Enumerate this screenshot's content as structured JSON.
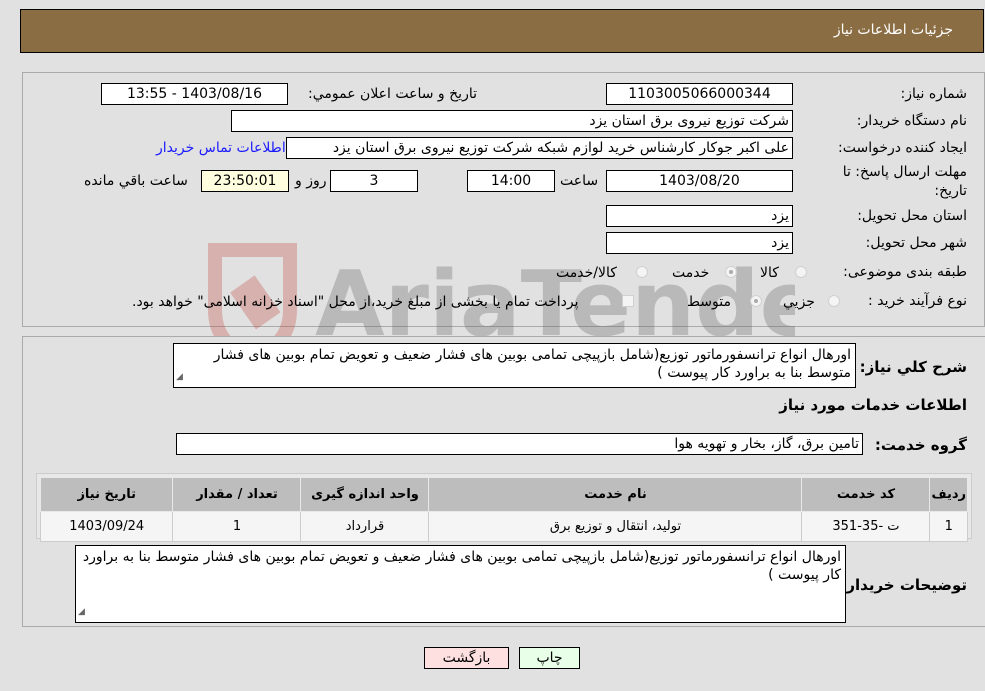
{
  "header": {
    "title": "جزئیات اطلاعات نیاز"
  },
  "fields": {
    "need_number": {
      "label": "شماره نیاز:",
      "value": "1103005066000344"
    },
    "announce_datetime": {
      "label": "تاریخ و ساعت اعلان عمومي:",
      "value": "1403/08/16 - 13:55"
    },
    "buyer_org": {
      "label": "نام دستگاه خریدار:",
      "value": "شرکت توزیع نیروی برق استان یزد"
    },
    "requester": {
      "label": "ایجاد کننده درخواست:",
      "value": "علی اکبر  جوکار  کارشناس خرید لوازم شبکه  شرکت توزیع نیروی برق استان یزد"
    },
    "contact_link": "اطلاعات تماس خریدار",
    "deadline": {
      "label": "مهلت ارسال پاسخ: تا تاریخ:",
      "date": "1403/08/20",
      "time_label": "ساعت",
      "time": "14:00",
      "days": "3",
      "days_label": "روز و",
      "remaining": "23:50:01",
      "remaining_label": "ساعت باقي مانده"
    },
    "delivery_province": {
      "label": "استان محل تحویل:",
      "value": "یزد"
    },
    "delivery_city": {
      "label": "شهر محل تحویل:",
      "value": "یزد"
    },
    "category": {
      "label": "طبقه بندی موضوعی:",
      "options": [
        "کالا",
        "خدمت",
        "کالا/خدمت"
      ],
      "selected": "خدمت"
    },
    "purchase_type": {
      "label": "نوع فرآیند خرید :",
      "options": [
        "جزيي",
        "متوسط"
      ],
      "selected": "متوسط",
      "treasury_note": "پرداخت تمام یا بخشی از مبلغ خرید،از محل \"اسناد خزانه اسلامی\" خواهد بود."
    }
  },
  "description": {
    "label": "شرح کلي نیاز:",
    "value": "اورهال انواع ترانسفورماتور توزیع(شامل بازپیچی تمامی بوبین های فشار ضعیف و تعویض تمام بوبین های فشار متوسط بنا به براورد کار پیوست )"
  },
  "services_section_title": "اطلاعات خدمات مورد نیاز",
  "service_group": {
    "label": "گروه خدمت:",
    "value": "تامین برق، گاز، بخار و تهویه هوا"
  },
  "table": {
    "headers": [
      "ردیف",
      "کد خدمت",
      "نام خدمت",
      "واحد اندازه گیری",
      "تعداد / مقدار",
      "تاریخ نیاز"
    ],
    "rows": [
      [
        "1",
        "ت -35-351",
        "تولید، انتقال و توزیع برق",
        "قرارداد",
        "1",
        "1403/09/24"
      ]
    ]
  },
  "buyer_notes": {
    "label": "توضیحات خریدار:",
    "value": "اورهال انواع ترانسفورماتور توزیع(شامل بازپیچی تمامی بوبین های فشار ضعیف و تعویض تمام بوبین های فشار متوسط بنا به براورد کار پیوست )"
  },
  "buttons": {
    "print": "چاپ",
    "back": "بازگشت"
  },
  "colors": {
    "header_bg": "#8b6d43",
    "back_btn": "#ffe0e0",
    "print_btn": "#e8ffe8",
    "countdown_bg": "#ffffe0"
  }
}
